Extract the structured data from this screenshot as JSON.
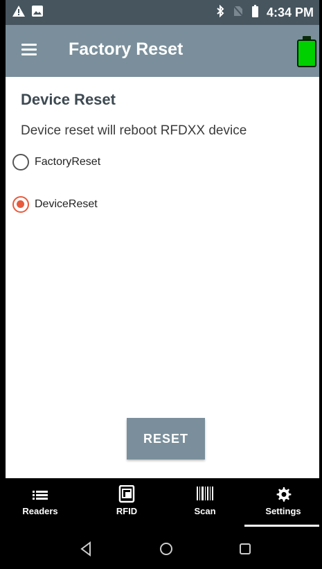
{
  "status_bar": {
    "time": "4:34 PM",
    "icons": [
      "warning-icon",
      "image-icon",
      "bluetooth-icon",
      "no-sim-icon",
      "battery-small-icon"
    ]
  },
  "app_bar": {
    "title": "Factory Reset",
    "battery_color": "#00d000"
  },
  "content": {
    "section_title": "Device Reset",
    "description": "Device reset will reboot RFDXX device",
    "options": [
      {
        "label": "FactoryReset",
        "selected": false
      },
      {
        "label": "DeviceReset",
        "selected": true
      }
    ],
    "button_label": "RESET"
  },
  "bottom_nav": {
    "items": [
      {
        "label": "Readers",
        "icon": "list-icon",
        "active": false
      },
      {
        "label": "RFID",
        "icon": "rfid-icon",
        "active": false
      },
      {
        "label": "Scan",
        "icon": "barcode-icon",
        "active": false
      },
      {
        "label": "Settings",
        "icon": "gear-icon",
        "active": true
      }
    ]
  },
  "system_nav": {
    "buttons": [
      "back-icon",
      "home-icon",
      "recents-icon"
    ]
  },
  "colors": {
    "status_bar": "#46555e",
    "app_bar": "#7a8f9b",
    "accent": "#e85a3c"
  }
}
